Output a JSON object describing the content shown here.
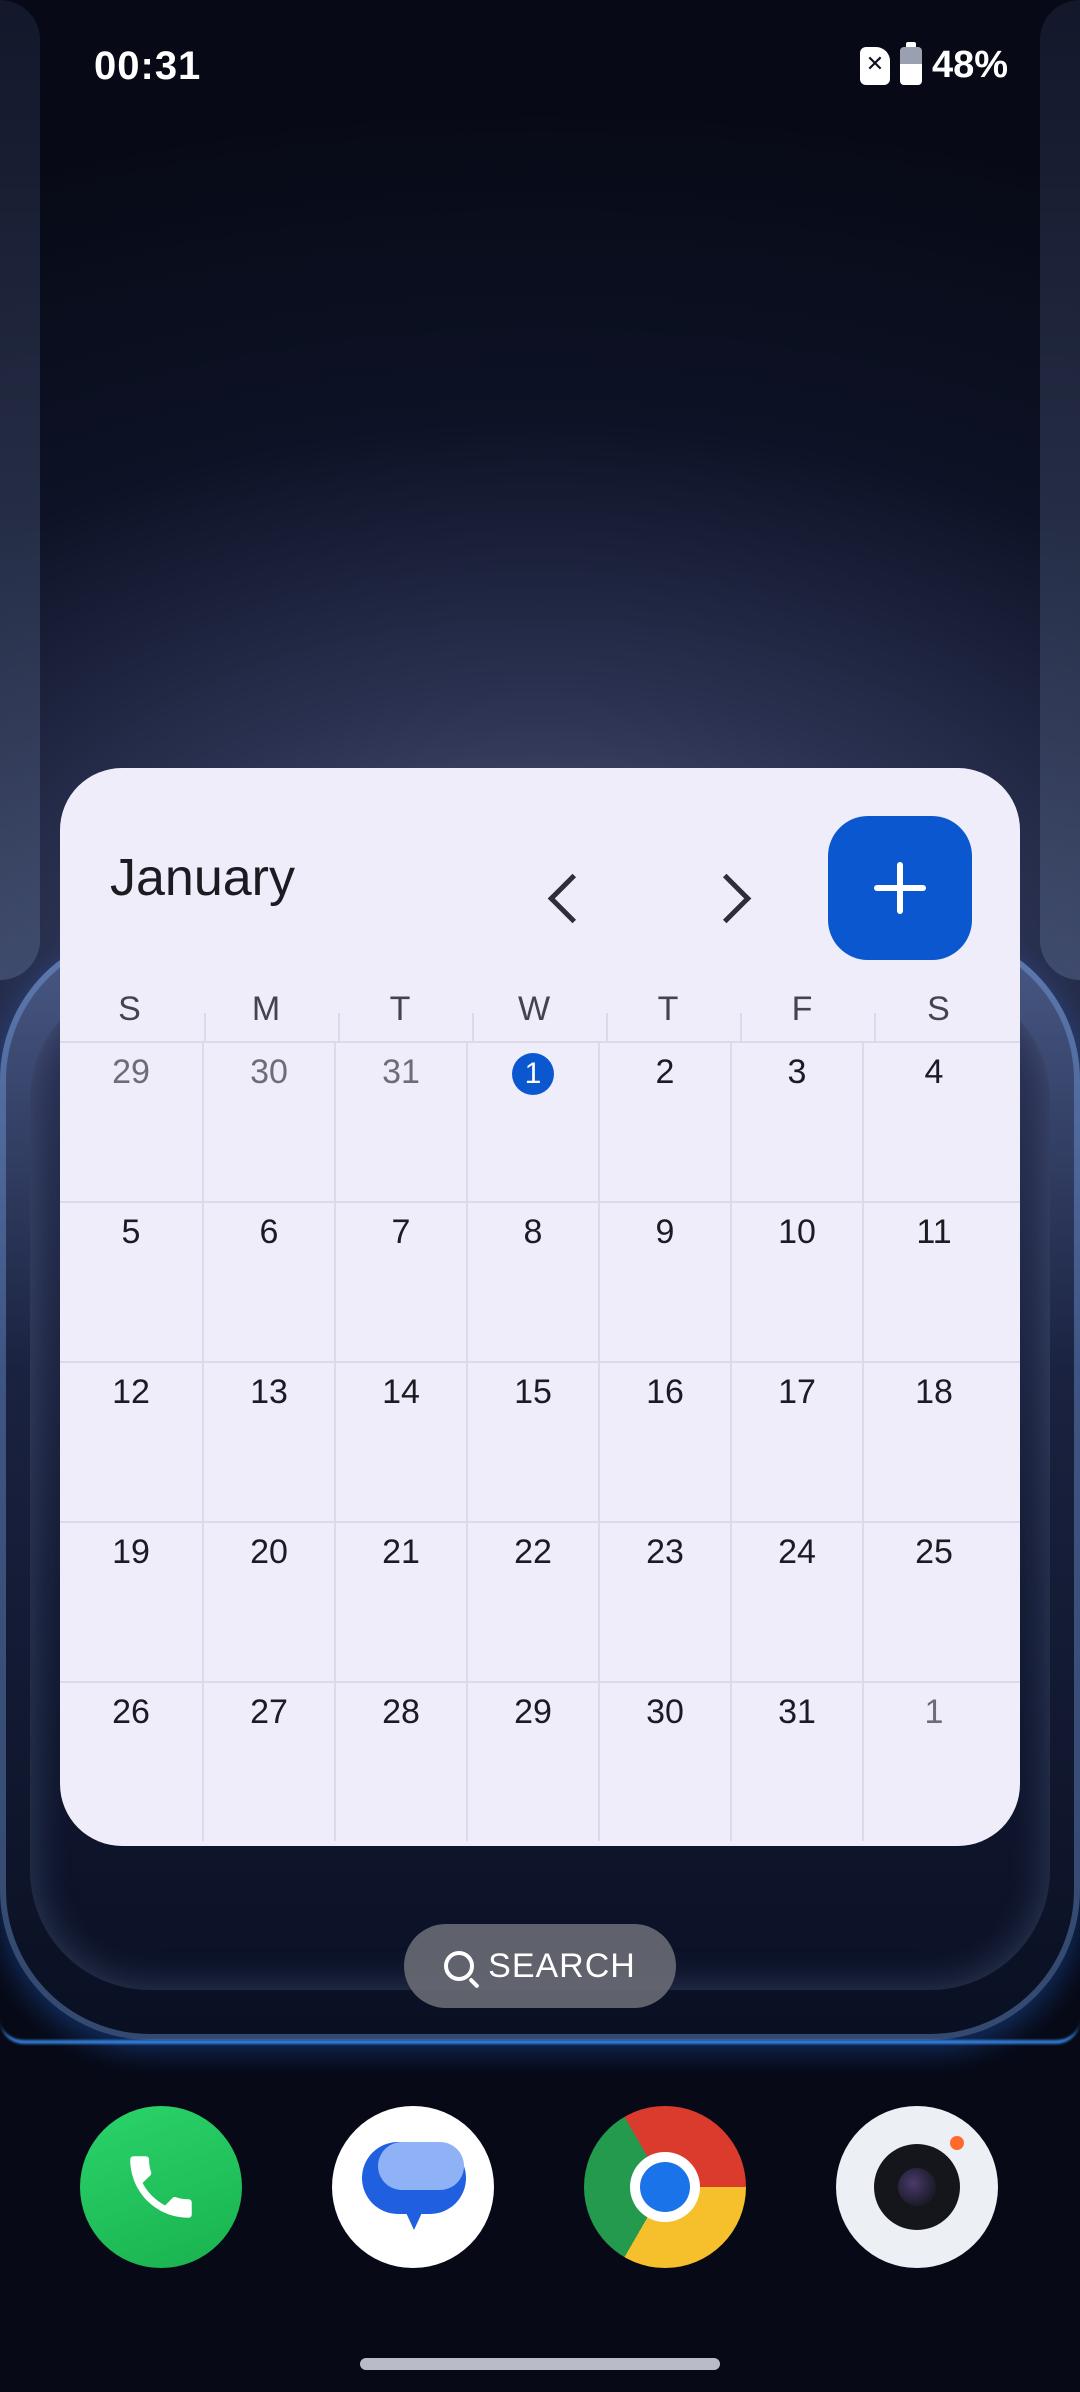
{
  "status_bar": {
    "time": "00:31",
    "battery_percent": "48%",
    "sim_icon": "sim-error-icon",
    "battery_icon": "battery-icon"
  },
  "calendar": {
    "month": "January",
    "prev_icon": "chevron-left-icon",
    "next_icon": "chevron-right-icon",
    "add_icon": "plus-icon",
    "colors": {
      "accent": "#0b57d0",
      "widget_bg": "#efedfa"
    },
    "weekdays": [
      "S",
      "M",
      "T",
      "W",
      "T",
      "F",
      "S"
    ],
    "weeks": [
      [
        "29",
        "30",
        "31",
        "1",
        "2",
        "3",
        "4"
      ],
      [
        "5",
        "6",
        "7",
        "8",
        "9",
        "10",
        "11"
      ],
      [
        "12",
        "13",
        "14",
        "15",
        "16",
        "17",
        "18"
      ],
      [
        "19",
        "20",
        "21",
        "22",
        "23",
        "24",
        "25"
      ],
      [
        "26",
        "27",
        "28",
        "29",
        "30",
        "31",
        "1"
      ]
    ]
  },
  "search": {
    "label": "SEARCH",
    "icon": "search-icon"
  },
  "dock": {
    "apps": [
      {
        "name": "Phone",
        "icon": "phone-icon"
      },
      {
        "name": "Messages",
        "icon": "messages-icon"
      },
      {
        "name": "Chrome",
        "icon": "chrome-icon"
      },
      {
        "name": "Camera",
        "icon": "camera-icon"
      }
    ]
  }
}
